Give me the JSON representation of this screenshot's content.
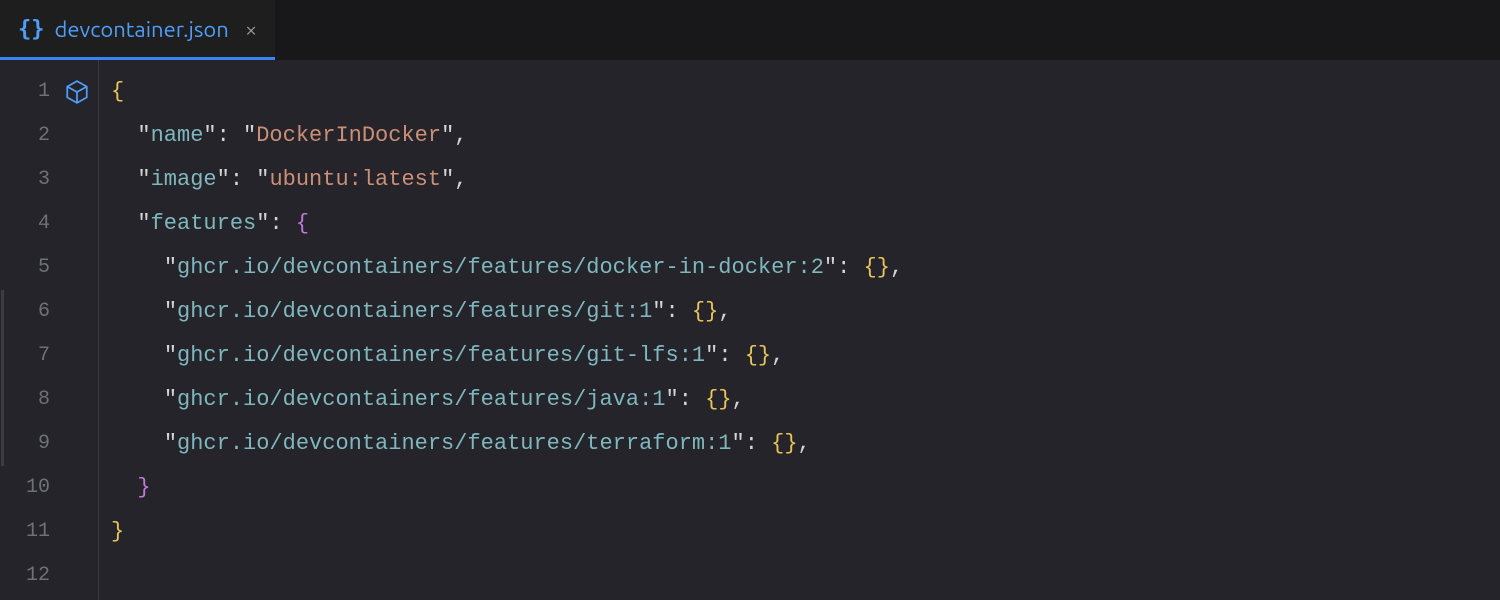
{
  "tab": {
    "filename": "devcontainer.json",
    "icon": "json-braces-icon",
    "close": "×"
  },
  "gutter": {
    "lines": [
      "1",
      "2",
      "3",
      "4",
      "5",
      "6",
      "7",
      "8",
      "9",
      "10",
      "11",
      "12"
    ]
  },
  "code": {
    "indent2": "  ",
    "indent4": "    ",
    "open_brace": "{",
    "close_brace": "}",
    "open_brace2": "{",
    "close_brace2": "}",
    "empty_obj_open": "{",
    "empty_obj_close": "}",
    "colon": ":",
    "comma": ",",
    "dq": "\"",
    "sp": " ",
    "keys": {
      "name": "name",
      "image": "image",
      "features": "features",
      "f_docker": "ghcr.io/devcontainers/features/docker-in-docker:2",
      "f_git": "ghcr.io/devcontainers/features/git:1",
      "f_gitlfs": "ghcr.io/devcontainers/features/git-lfs:1",
      "f_java": "ghcr.io/devcontainers/features/java:1",
      "f_terraform": "ghcr.io/devcontainers/features/terraform:1"
    },
    "values": {
      "name": "DockerInDocker",
      "image": "ubuntu:latest"
    }
  }
}
